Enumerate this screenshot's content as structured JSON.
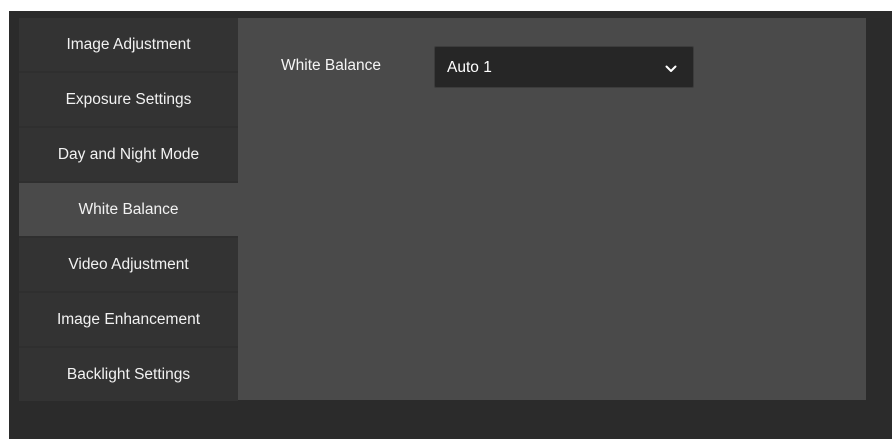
{
  "sidebar": {
    "items": [
      {
        "label": "Image Adjustment",
        "active": false
      },
      {
        "label": "Exposure Settings",
        "active": false
      },
      {
        "label": "Day and Night Mode",
        "active": false
      },
      {
        "label": "White Balance",
        "active": true
      },
      {
        "label": "Video Adjustment",
        "active": false
      },
      {
        "label": "Image Enhancement",
        "active": false
      },
      {
        "label": "Backlight Settings",
        "active": false
      }
    ]
  },
  "main": {
    "white_balance": {
      "label": "White Balance",
      "value": "Auto 1",
      "icon": "chevron-down-icon"
    }
  },
  "colors": {
    "frame_bg": "#2b2b2b",
    "sidebar_item_bg": "#333333",
    "active_item_bg": "#4a4a4a",
    "content_bg": "#4a4a4a",
    "select_bg": "#262626",
    "text": "#f2f2f2"
  }
}
